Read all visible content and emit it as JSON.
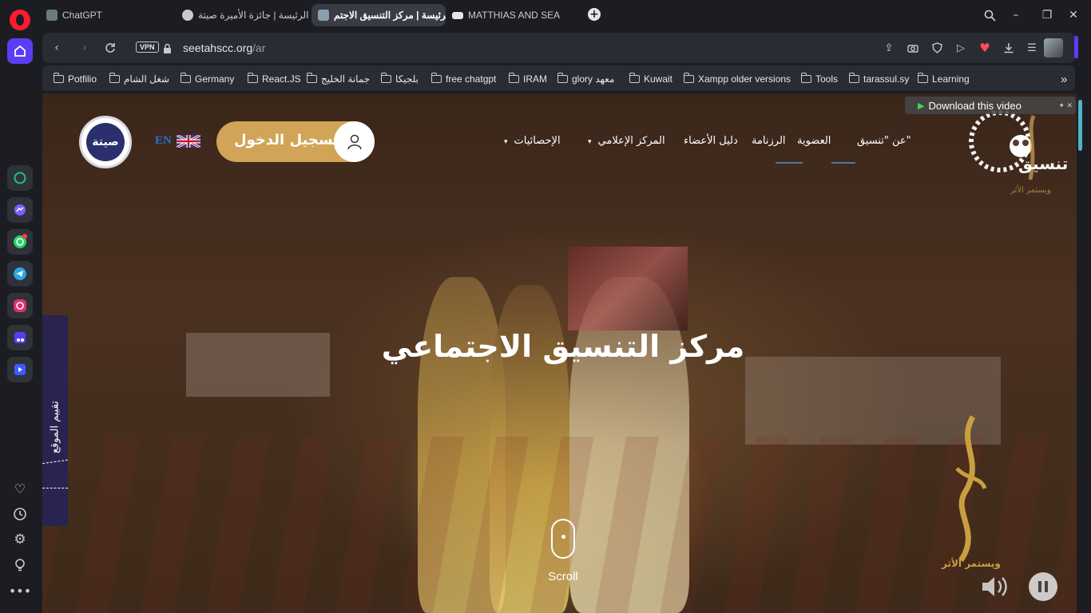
{
  "browser": {
    "tabs": [
      {
        "label": "ChatGPT",
        "active": false
      },
      {
        "label": "الرئيسة | جائزة الأميرة صيتة",
        "active": false
      },
      {
        "label": "الرئيسة | مركز التنسيق الاجتم",
        "active": true
      },
      {
        "label": "MATTHIAS AND SEA",
        "active": false
      }
    ],
    "new_tab_label": "+",
    "window_controls": {
      "minimize": "–",
      "maximize": "❐",
      "close": "✕"
    },
    "address": {
      "vpn": "VPN",
      "domain": "seetahscc.org",
      "path": "/ar"
    },
    "bookmarks": [
      "Potfilio",
      "شغل الشام",
      "Germany",
      "React.JS",
      "جمانة الخليج",
      "بلجيكا",
      "free chatgpt",
      "IRAM",
      "glory معهد",
      "Kuwait",
      "Xampp older versions",
      "Tools",
      "tarassul.sy",
      "Learning"
    ],
    "more_bookmarks_icon": "»"
  },
  "sidebar": {
    "apps": [
      "chatgpt-icon",
      "messenger-icon",
      "whatsapp-icon",
      "telegram-icon",
      "instagram-icon",
      "music-icon",
      "video-player-icon"
    ],
    "bottom": [
      "heart-icon",
      "history-icon",
      "settings-icon",
      "bulb-icon",
      "more-icon"
    ]
  },
  "site": {
    "logo_text": "تنسيق",
    "logo_tagline": "ويستمر الأثر",
    "nav": [
      "عن \"تنسيق\"",
      "العضوية",
      "الرزنامة",
      "دليل الأعضاء",
      "المركز الإعلامي",
      "الإحصائيات"
    ],
    "language": "EN",
    "login_label": "تسجيل الدخول",
    "partner_logo_text": "صيتة",
    "hero_title": "مركز التنسيق الاجتماعي",
    "side_tab": "تقييم الموقع",
    "download_video": "Download this video",
    "scroll_label": "Scroll",
    "watermark_tagline": "ويستمر الأثر"
  }
}
